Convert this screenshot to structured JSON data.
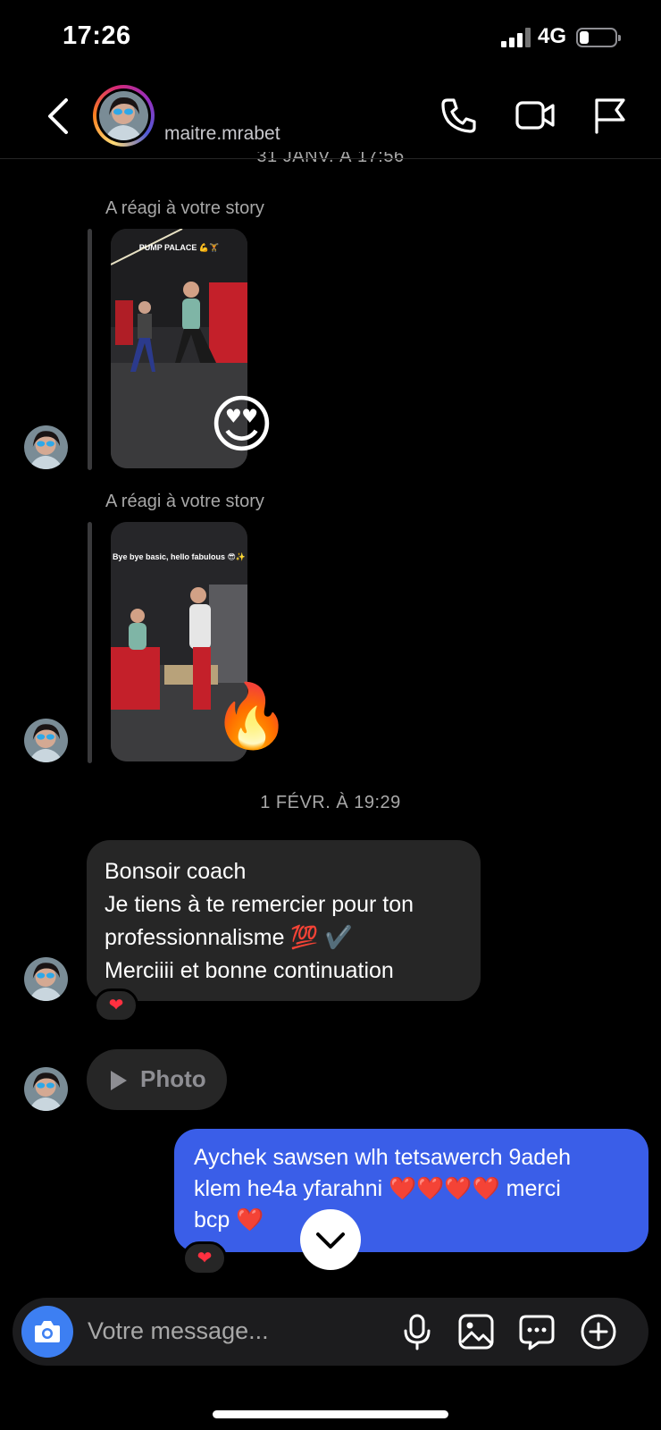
{
  "status_bar": {
    "time": "17:26",
    "network": "4G"
  },
  "header": {
    "username": "maitre.mrabet"
  },
  "thread": {
    "date_top": "31 JANV. À 17:56",
    "stories": [
      {
        "label": "A réagi à votre story",
        "caption": "PUMP PALACE 💪🏋",
        "reaction_emoji": "😍"
      },
      {
        "label": "A réagi à votre story",
        "caption": "Bye bye basic, hello fabulous 😎✨",
        "reaction_emoji": "🔥"
      }
    ],
    "date_mid": "1 FÉVR. À 19:29",
    "incoming_message": {
      "lines": [
        "Bonsoir coach",
        "Je tiens à te remercier pour ton",
        "professionnalisme 💯 ✔️",
        "Merciiii et bonne continuation"
      ],
      "reaction": "❤"
    },
    "photo_message": {
      "label": "Photo"
    },
    "outgoing_message": {
      "lines": [
        "Aychek sawsen wlh tetsawerch 9adeh",
        "klem he4a yfarahni ❤️❤️❤️❤️ merci",
        "bcp ❤️"
      ],
      "reaction": "❤"
    }
  },
  "composer": {
    "placeholder": "Votre message..."
  },
  "colors": {
    "outgoing_bubble": "#3a5ee8",
    "incoming_bubble": "#262626",
    "camera_button": "#3d7ff2"
  }
}
